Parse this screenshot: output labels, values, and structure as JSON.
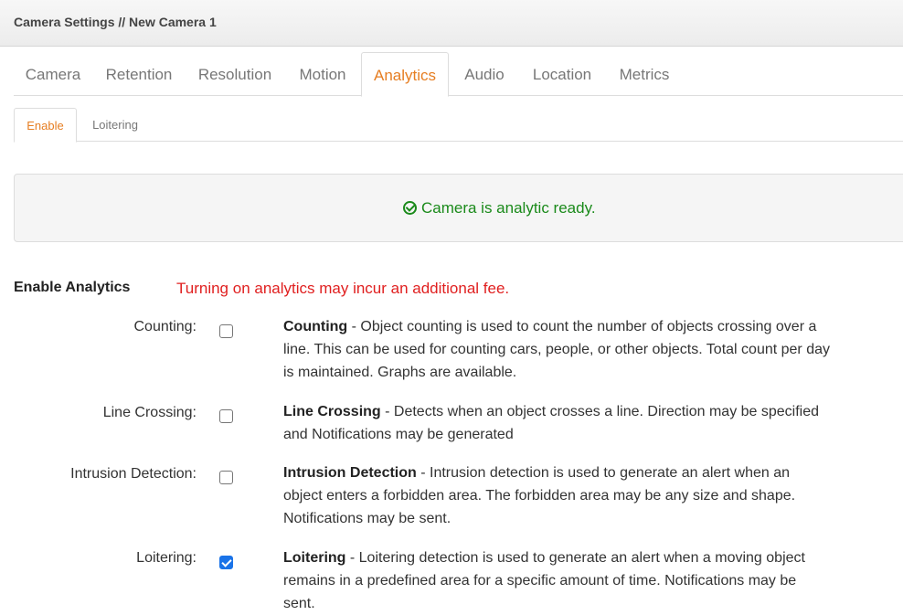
{
  "header": {
    "title": "Camera Settings // New Camera 1"
  },
  "tabs": [
    {
      "label": "Camera",
      "active": false
    },
    {
      "label": "Retention",
      "active": false
    },
    {
      "label": "Resolution",
      "active": false
    },
    {
      "label": "Motion",
      "active": false
    },
    {
      "label": "Analytics",
      "active": true
    },
    {
      "label": "Audio",
      "active": false
    },
    {
      "label": "Location",
      "active": false
    },
    {
      "label": "Metrics",
      "active": false
    }
  ],
  "subtabs": [
    {
      "label": "Enable",
      "active": true
    },
    {
      "label": "Loitering",
      "active": false
    }
  ],
  "status": {
    "message": "Camera is analytic ready.",
    "color": "#1a8a1a"
  },
  "analytics": {
    "title": "Enable Analytics",
    "fee_warning": "Turning on analytics may incur an additional fee.",
    "items": [
      {
        "label": "Counting:",
        "checked": false,
        "name": "Counting",
        "description": " - Object counting is used to count the number of objects crossing over a line. This can be used for counting cars, people, or other objects. Total count per day is maintained. Graphs are available."
      },
      {
        "label": "Line Crossing:",
        "checked": false,
        "name": "Line Crossing",
        "description": " - Detects when an object crosses a line. Direction may be specified and Notifications may be generated"
      },
      {
        "label": "Intrusion Detection:",
        "checked": false,
        "name": "Intrusion Detection",
        "description": " - Intrusion detection is used to generate an alert when an object enters a forbidden area. The forbidden area may be any size and shape. Notifications may be sent."
      },
      {
        "label": "Loitering:",
        "checked": true,
        "name": "Loitering",
        "description": " - Loitering detection is used to generate an alert when a moving object remains in a predefined area for a specific amount of time. Notifications may be sent."
      }
    ]
  },
  "colors": {
    "accent": "#e67e22",
    "warning": "#e02020",
    "checkbox": "#1a73e8"
  }
}
